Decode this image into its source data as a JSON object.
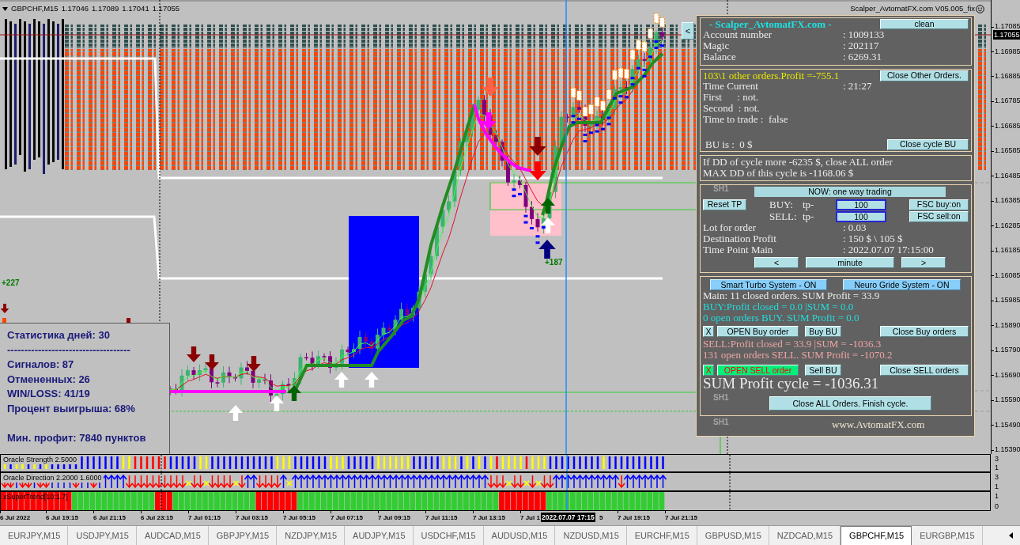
{
  "chart_header": {
    "symbol": "GBPCHF,M15",
    "ohlc": [
      "1.17046",
      "1.17089",
      "1.17041",
      "1.17055"
    ]
  },
  "expert_title": "Scalper_AvtomatFX.com V05.005_fix",
  "chart_labels": {
    "profits": [
      "+227",
      "+187"
    ],
    "levels": [
      "SH1",
      "SH1",
      "SH1"
    ]
  },
  "stats": {
    "title": "Статистика дней: 30",
    "divider": "------------------------------------",
    "lines": [
      "Сигналов: 87",
      "Отмененных: 26",
      "WIN/LOSS: 41/19",
      "Процент выигрыша: 68%"
    ],
    "footer": "Мин. профит: 7840 пунктов"
  },
  "panel": {
    "collapse_button": "<",
    "account": {
      "title": "- Scalper_AvtomatFX.com -",
      "clean_button": "clean",
      "rows": [
        {
          "label": "Account number",
          "value": ": 1009133"
        },
        {
          "label": "Magic",
          "value": ": 202117"
        },
        {
          "label": "Balance",
          "value": ": 6269.31"
        }
      ]
    },
    "orders": {
      "summary": "103\\1 other orders.Profit =-755.1",
      "close_button": "Close Other Orders.",
      "rows": [
        {
          "label": "Time Current",
          "value": ": 21:27"
        }
      ],
      "lines": [
        "First      : not.",
        "Second  : not.",
        "Time to trade :  false"
      ],
      "bu": "BU is :  0 $",
      "bu_button": "Close cycle BU"
    },
    "drawdown": {
      "lines": [
        "If DD of cycle more -6235 $, close ALL order",
        "MAX DD of this cycle is -1168.06 $"
      ]
    },
    "trading": {
      "mode": "NOW: one way trading",
      "reset_button": "Reset TP",
      "tp_rows": [
        {
          "side": "BUY:",
          "prefix": "tp-",
          "value": "100",
          "fsc_button": "FSC buy:on"
        },
        {
          "side": "SELL:",
          "prefix": "tp-",
          "value": "100",
          "fsc_button": "FSC sell:on"
        }
      ],
      "rows": [
        {
          "label": "Lot for order",
          "value": ": 0.03"
        },
        {
          "label": "Destination Profit",
          "value": ": 150 $ \\ 105 $"
        },
        {
          "label": "Time Point Main",
          "value": ": 2022.07.07 17:15:00"
        }
      ],
      "nav_buttons": [
        "<",
        "minute",
        ">"
      ]
    },
    "results": {
      "systems": [
        "Smart Turbo System - ON",
        "Neuro Gride System - ON"
      ],
      "main": "Main: 11 closed orders. SUM Profit = 33.9",
      "sides": [
        {
          "kind": "buy",
          "lines": [
            "BUY:Profit closed = 0.0 |SUM = 0.0",
            "0 open orders BUY. SUM Profit = 0.0"
          ],
          "toggle": {
            "label": "X",
            "on": false
          },
          "open_button": {
            "label": "OPEN Buy order",
            "on": false
          },
          "bu_button": "Buy BU",
          "close_button": "Close Buy orders"
        },
        {
          "kind": "sell",
          "lines": [
            "SELL:Profit closed = 33.9 |SUM = -1036.3",
            "131 open orders SELL. SUM Profit = -1070.2"
          ],
          "toggle": {
            "label": "X",
            "on": true
          },
          "open_button": {
            "label": "OPEN SELL order",
            "on": true
          },
          "bu_button": "Sell BU",
          "close_button": "Close SELL orders"
        }
      ],
      "sum": "SUM Profit cycle = -1036.31",
      "close_all_button": "Close ALL Orders. Finish cycle."
    },
    "footer": "www.AvtomatFX.com"
  },
  "price_axis": {
    "labels": [
      "1.17085",
      "1.16985",
      "1.16885",
      "1.16785",
      "1.16685",
      "1.16585",
      "1.16485",
      "1.16385",
      "1.16285",
      "1.16185",
      "1.16085",
      "1.15985",
      "1.15890",
      "1.15790",
      "1.15690",
      "1.15590",
      "1.15490",
      "1.15390"
    ],
    "current": "1.17055"
  },
  "indicators": [
    {
      "kind": "strength",
      "label": "Oracle Strength 2.5000",
      "scale": [
        "3",
        "1"
      ]
    },
    {
      "kind": "direction",
      "label": "Oracle Direction 2.2000 1.6000",
      "scale": [
        "3",
        "1"
      ]
    },
    {
      "kind": "supertrend",
      "label": "xSuperTrend[10;1.7]",
      "scale": [
        "1",
        "0"
      ]
    }
  ],
  "time_axis": {
    "labels_before_cursor": [
      "6 Jul 2022",
      "6 Jul 19:15",
      "6 Jul 21:15",
      "6 Jul 23:15",
      "7 Jul 01:15",
      "7 Jul 03:15",
      "7 Jul 05:15",
      "7 Jul 07:15",
      "7 Jul 09:15",
      "7 Jul 11:15",
      "7 Jul 13:15",
      "7 Jul 1"
    ],
    "cursor": "2022.07.07 17:15",
    "labels_after_cursor": [
      "5",
      "7 Jul 19:15",
      "7 Jul 21:15"
    ]
  },
  "tabs": [
    {
      "label": "EURJPY,M15",
      "selected": false
    },
    {
      "label": "USDJPY,M15",
      "selected": false
    },
    {
      "label": "AUDCAD,M15",
      "selected": false
    },
    {
      "label": "GBPJPY,M15",
      "selected": false
    },
    {
      "label": "NZDJPY,M15",
      "selected": false
    },
    {
      "label": "AUDJPY,M15",
      "selected": false
    },
    {
      "label": "USDCHF,M15",
      "selected": false
    },
    {
      "label": "AUDUSD,M15",
      "selected": false
    },
    {
      "label": "NZDUSD,M15",
      "selected": false
    },
    {
      "label": "EURCHF,M15",
      "selected": false
    },
    {
      "label": "GBPUSD,M15",
      "selected": false
    },
    {
      "label": "NZDCAD,M15",
      "selected": false
    },
    {
      "label": "GBPCHF,M15",
      "selected": true
    },
    {
      "label": "EURGBP,M15",
      "selected": false
    }
  ]
}
